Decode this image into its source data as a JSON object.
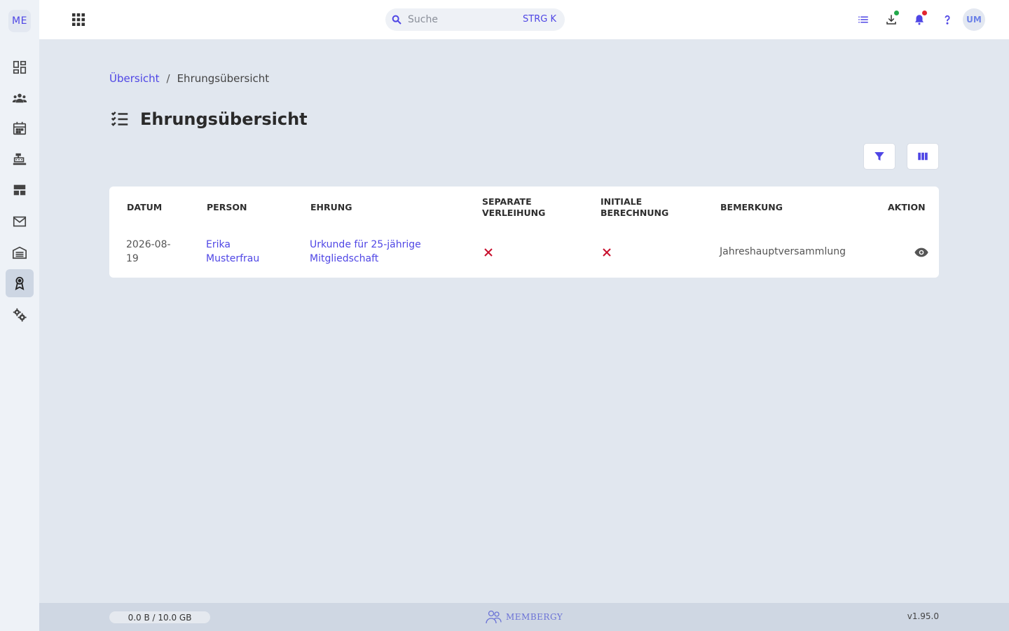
{
  "sidebar": {
    "logo": "ME",
    "items": [
      {
        "icon": "dashboard-icon"
      },
      {
        "icon": "people-icon"
      },
      {
        "icon": "calendar-icon"
      },
      {
        "icon": "cash-register-icon"
      },
      {
        "icon": "table-layout-icon"
      },
      {
        "icon": "mail-icon"
      },
      {
        "icon": "warehouse-icon"
      },
      {
        "icon": "award-icon",
        "active": true
      },
      {
        "icon": "settings-gears-icon"
      }
    ]
  },
  "topbar": {
    "search_placeholder": "Suche",
    "search_shortcut": "STRG K",
    "avatar": "UM"
  },
  "breadcrumb": {
    "home": "Übersicht",
    "separator": "/",
    "current": "Ehrungsübersicht"
  },
  "page_title": "Ehrungsübersicht",
  "table": {
    "headers": {
      "datum": "DATUM",
      "person": "PERSON",
      "ehrung": "EHRUNG",
      "separate_1": "SEPARATE",
      "separate_2": "VERLEIHUNG",
      "initiale_1": "INITIALE",
      "initiale_2": "BERECHNUNG",
      "bemerkung": "BEMERKUNG",
      "aktion": "AKTION"
    },
    "rows": [
      {
        "datum_1": "2026-08-",
        "datum_2": "19",
        "person_1": "Erika",
        "person_2": "Musterfrau",
        "ehrung_1": "Urkunde für 25-jährige",
        "ehrung_2": "Mitgliedschaft",
        "separate_verleihung": false,
        "initiale_berechnung": false,
        "bemerkung": "Jahreshauptversammlung"
      }
    ]
  },
  "footer": {
    "storage": "0.0 B / 10.0 GB",
    "brand": "MEMBERGY",
    "version": "v1.95.0"
  },
  "colors": {
    "accent": "#4f46e5",
    "false_mark": "#c8102e",
    "download_dot": "#22a94b",
    "notification_dot": "#e3262f"
  }
}
